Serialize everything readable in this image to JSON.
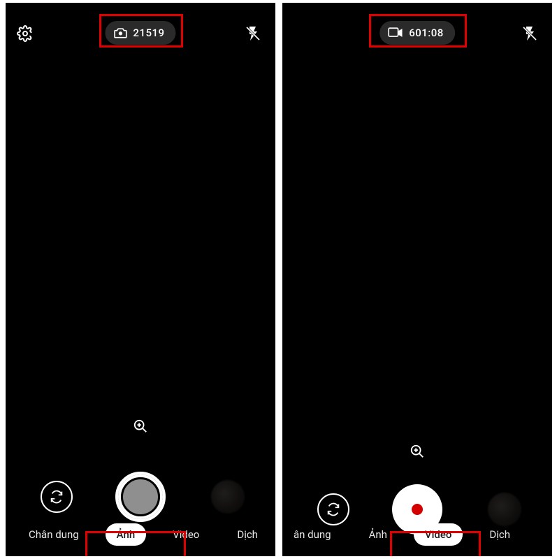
{
  "left": {
    "counter": "21519",
    "modes": [
      "Chân dung",
      "Ảnh",
      "Video",
      "Dịch"
    ],
    "active_mode_index": 1
  },
  "right": {
    "counter": "601:08",
    "modes": [
      "ân dung",
      "Ảnh",
      "Video",
      "Dịch"
    ],
    "active_mode_index": 2
  },
  "icons": {
    "settings": "settings-icon",
    "flash_off": "flash-off-icon",
    "camera": "camera-icon",
    "video": "video-icon",
    "zoom": "zoom-in-icon",
    "switch": "switch-camera-icon"
  },
  "colors": {
    "highlight": "#e00000",
    "pill_bg": "#2a2a2a",
    "shutter_photo": "#8f8f8f",
    "record_dot": "#d40000"
  }
}
